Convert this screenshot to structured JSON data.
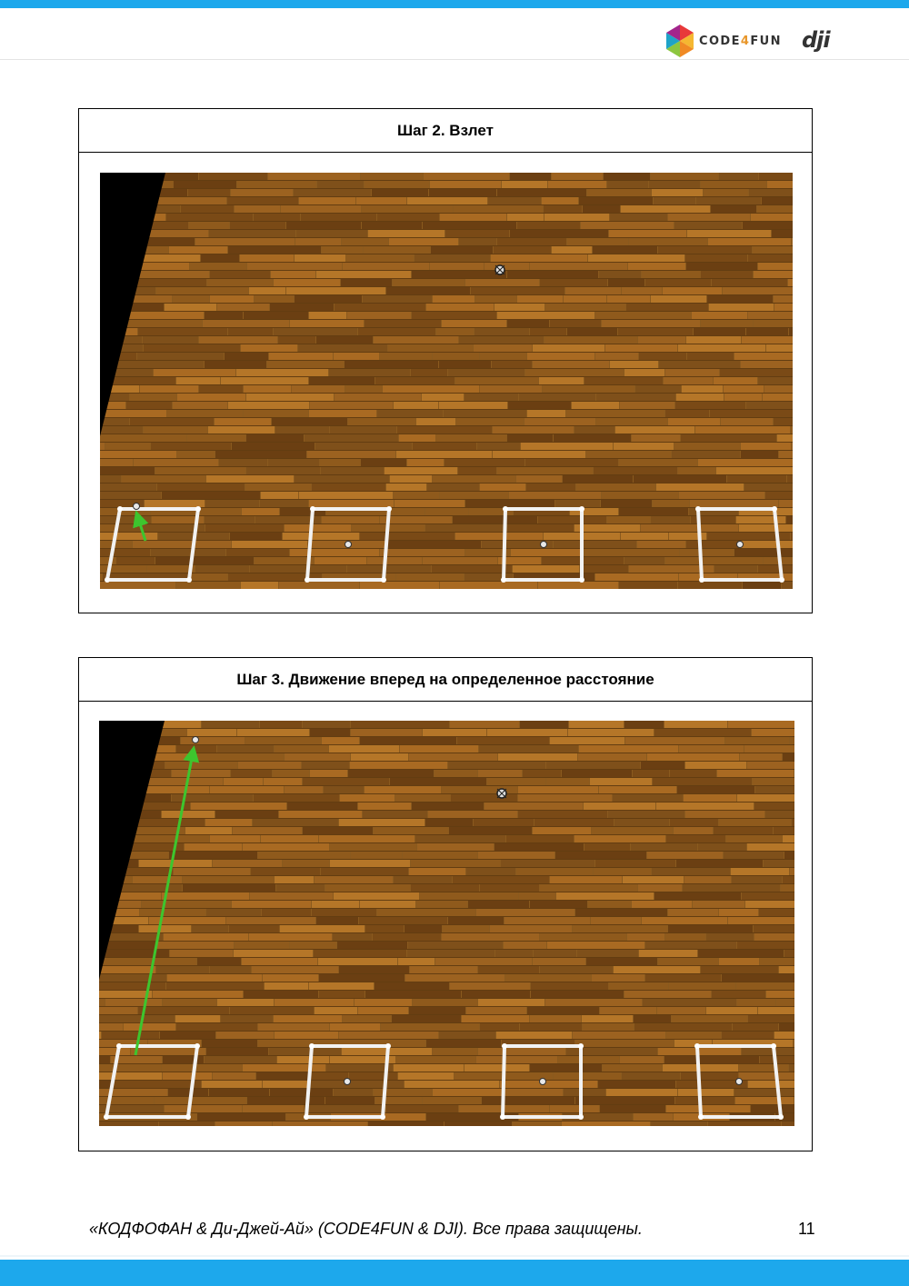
{
  "header": {
    "brand_code4fun": {
      "text_main": "CODE",
      "text_four": "4",
      "text_end": "FUN"
    },
    "brand_dji": "dji"
  },
  "steps": [
    {
      "title": "Шаг 2. Взлет"
    },
    {
      "title": "Шаг 3. Движение вперед на определенное расстояние"
    }
  ],
  "footer": {
    "copyright": "«КОДФОФАН & Ди-Джей-Ай» (CODE4FUN & DJI). Все права защищены.",
    "page_number": "11"
  },
  "colors": {
    "accent_bar": "#1da8ec",
    "wood_base": "#8a5a1e",
    "arrow": "#3ec52e"
  }
}
